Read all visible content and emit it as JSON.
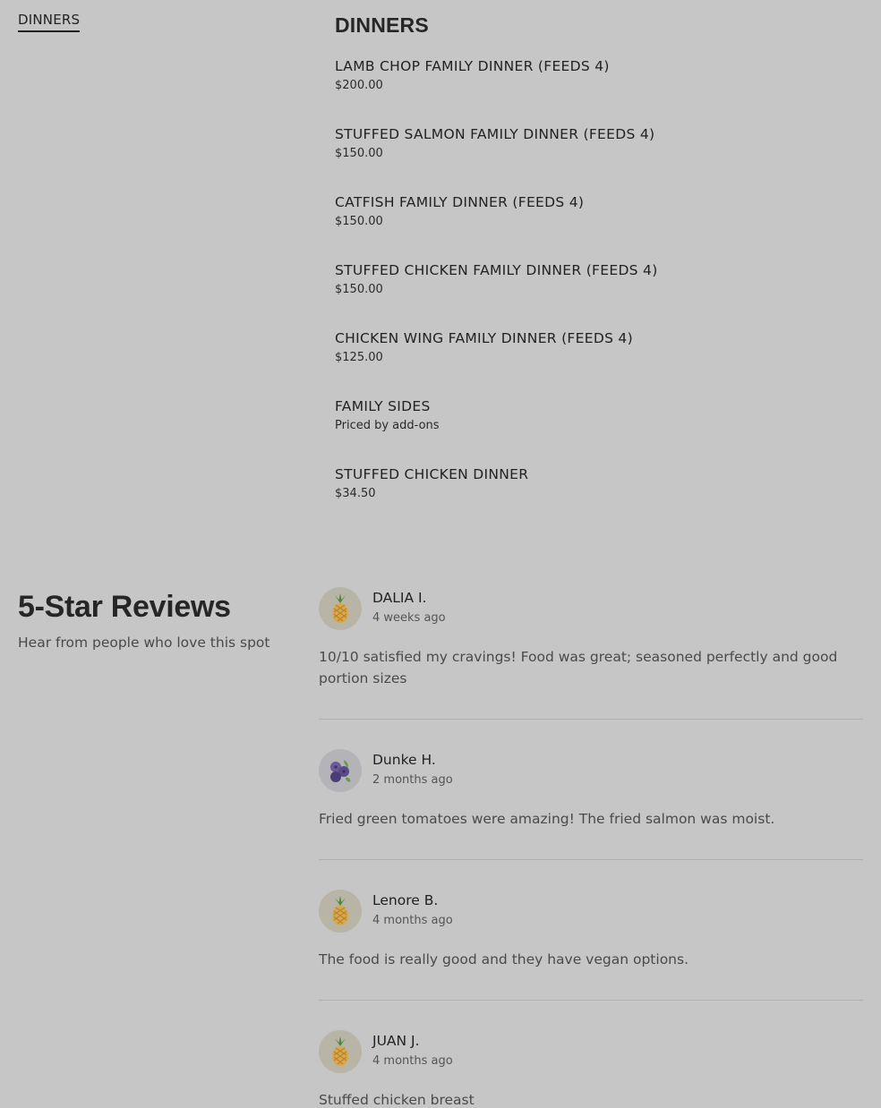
{
  "nav": {
    "items": [
      {
        "label": "DINNERS"
      }
    ]
  },
  "menu": {
    "heading": "DINNERS",
    "items": [
      {
        "name": "LAMB CHOP FAMILY DINNER (FEEDS 4)",
        "price": "$200.00"
      },
      {
        "name": "STUFFED SALMON FAMILY DINNER (FEEDS 4)",
        "price": "$150.00"
      },
      {
        "name": "CATFISH FAMILY DINNER (FEEDS 4)",
        "price": "$150.00"
      },
      {
        "name": "STUFFED CHICKEN FAMILY DINNER (FEEDS 4)",
        "price": "$150.00"
      },
      {
        "name": "CHICKEN WING FAMILY DINNER (FEEDS 4)",
        "price": "$125.00"
      },
      {
        "name": "FAMILY SIDES",
        "price": "Priced by add-ons"
      },
      {
        "name": "STUFFED CHICKEN DINNER",
        "price": "$34.50"
      }
    ]
  },
  "reviews": {
    "title": "5-Star Reviews",
    "subtitle": "Hear from people who love this spot",
    "items": [
      {
        "name": "DALIA I.",
        "time": "4 weeks ago",
        "text": "10/10 satisfied my cravings! Food was great; seasoned perfectly and good portion sizes",
        "avatar": "pineapple-icon"
      },
      {
        "name": "Dunke H.",
        "time": "2 months ago",
        "text": "Fried green tomatoes were amazing! The fried salmon was moist.",
        "avatar": "blueberries-icon"
      },
      {
        "name": "Lenore B.",
        "time": "4 months ago",
        "text": "The food is really good and they have vegan options.",
        "avatar": "pineapple-icon"
      },
      {
        "name": "JUAN J.",
        "time": "4 months ago",
        "text": "Stuffed chicken breast",
        "avatar": "pineapple-icon"
      }
    ]
  }
}
